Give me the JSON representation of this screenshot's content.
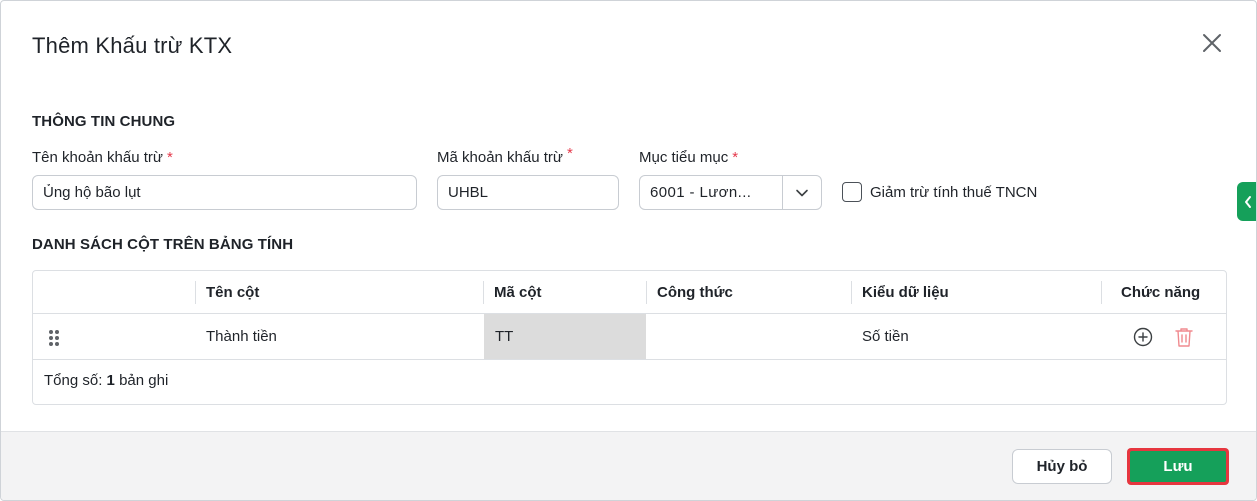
{
  "dialog": {
    "title": "Thêm Khấu trừ KTX"
  },
  "general": {
    "section_title": "THÔNG TIN CHUNG",
    "name_label": "Tên khoản khấu trừ",
    "name_value": "Ủng hộ bão lụt",
    "code_label": "Mã khoản khấu trừ",
    "code_value": "UHBL",
    "category_label": "Mục tiểu mục",
    "category_value": "6001 - Lươn...",
    "required_mark": "*",
    "tax_checkbox_label": "Giảm trừ tính thuế TNCN",
    "tax_checkbox_checked": false
  },
  "columns_table": {
    "section_title": "DANH SÁCH CỘT TRÊN BẢNG TÍNH",
    "headers": {
      "name": "Tên cột",
      "code": "Mã cột",
      "formula": "Công thức",
      "data_type": "Kiểu dữ liệu",
      "actions": "Chức năng"
    },
    "rows": [
      {
        "name": "Thành tiền",
        "code": "TT",
        "formula": "",
        "data_type": "Số tiền"
      }
    ],
    "total_prefix": "Tổng số:",
    "total_count": "1",
    "total_suffix": "bản ghi"
  },
  "footer": {
    "cancel_label": "Hủy bỏ",
    "save_label": "Lưu"
  },
  "colors": {
    "primary": "#15a05a",
    "required": "#e5384a",
    "delete_icon": "#f08a8f",
    "highlight_border": "#e6363f"
  }
}
